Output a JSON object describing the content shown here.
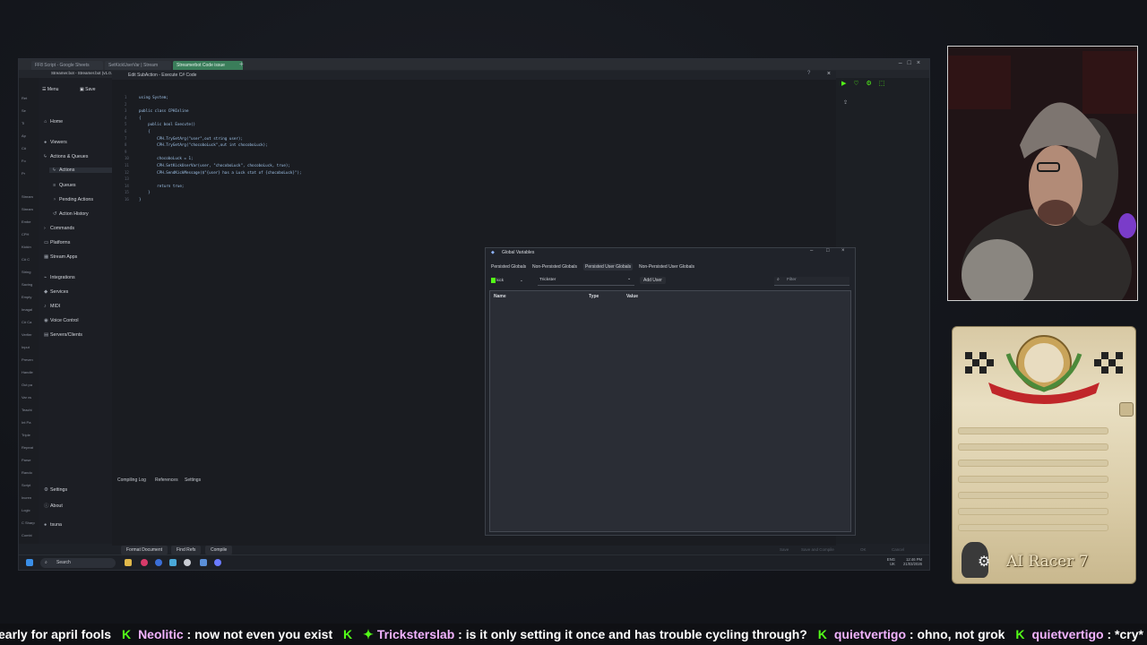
{
  "browser": {
    "tabs": [
      "FF8 Script - Google Sheets",
      "SetKickUserVar | Stream",
      "Streamerbot Code issue"
    ],
    "window_title": "Streamer.bot - Streamer.bot (v1.0.0)"
  },
  "app": {
    "menu_label": "Menu",
    "save_label": "Save",
    "nav": [
      {
        "label": "Home",
        "icon": "home-icon"
      },
      {
        "label": "Viewers",
        "icon": "users-icon"
      },
      {
        "label": "Actions & Queues",
        "icon": "bolt-icon"
      },
      {
        "label": "Actions",
        "icon": "bolt-icon",
        "sub": true,
        "selected": true
      },
      {
        "label": "Queues",
        "icon": "queue-icon",
        "sub": true
      },
      {
        "label": "Pending Actions",
        "icon": "pending-icon",
        "sub": true
      },
      {
        "label": "Action History",
        "icon": "history-icon",
        "sub": true
      },
      {
        "label": "Commands",
        "icon": "command-icon"
      },
      {
        "label": "Platforms",
        "icon": "platform-icon"
      },
      {
        "label": "Stream Apps",
        "icon": "apps-icon"
      },
      {
        "label": "Integrations",
        "icon": "plug-icon"
      },
      {
        "label": "Services",
        "icon": "services-icon"
      },
      {
        "label": "MIDI",
        "icon": "midi-icon"
      },
      {
        "label": "Voice Control",
        "icon": "mic-icon"
      },
      {
        "label": "Servers/Clients",
        "icon": "server-icon"
      }
    ],
    "nav_bottom": [
      {
        "label": "Settings",
        "icon": "gear-icon"
      },
      {
        "label": "About",
        "icon": "info-icon"
      },
      {
        "label": "tsuna",
        "icon": "avatar-icon"
      }
    ]
  },
  "editor": {
    "title": "Edit SubAction - Execute C# Code",
    "code": [
      "using System;",
      "",
      "public class CPHInline",
      "{",
      "    public bool Execute()",
      "    {",
      "        CPH.TryGetArg(\"user\",out string user);",
      "        CPH.TryGetArg(\"chocoboLuck\",out int chocoboLuck);",
      "",
      "        chocoboLuck = 1;",
      "        CPH.SetKickUserVar(user, \"chocoboLuck\", chocoboLuck, true);",
      "        CPH.SendKickMessage($\"{user} has a Luck stat of {chocoboLuck}\");",
      "",
      "        return true;",
      "    }",
      "}"
    ],
    "bottom_tabs": [
      "Compiling Log",
      "References",
      "Settings"
    ],
    "buttons": [
      "Format Document",
      "Find Refs",
      "Compile"
    ],
    "footer_buttons": [
      "Save",
      "Save and Compile",
      "OK",
      "Cancel"
    ]
  },
  "global_variables": {
    "title": "Global Variables",
    "tabs": [
      "Persisted Globals",
      "Non-Persisted Globals",
      "Persisted User Globals",
      "Non-Persisted User Globals"
    ],
    "active_tab": "Persisted User Globals",
    "platform": "kick",
    "user": "Trickster",
    "add_user_label": "Add User",
    "filter_placeholder": "Filter",
    "columns": [
      "Name",
      "Type",
      "Value"
    ]
  },
  "taskbar": {
    "search_label": "Search",
    "lang": "ENG",
    "region": "UK",
    "time": "12:46 PM",
    "date": "21/03/2026"
  },
  "card": {
    "name": "AI Racer 7"
  },
  "ticker": [
    {
      "user": "",
      "text": "early for april fools"
    },
    {
      "user": "Neolitic",
      "text": "now not even you exist"
    },
    {
      "user": "Trickstersl­ab",
      "text": "is it only setting it once and has trouble cycling through?"
    },
    {
      "user": "quietvertigo",
      "text": "ohno, not grok"
    },
    {
      "user": "quietvertigo",
      "text": "*cry*"
    }
  ],
  "colors": {
    "kick_green": "#53fc18",
    "accent_tab": "#3a7d5a"
  }
}
